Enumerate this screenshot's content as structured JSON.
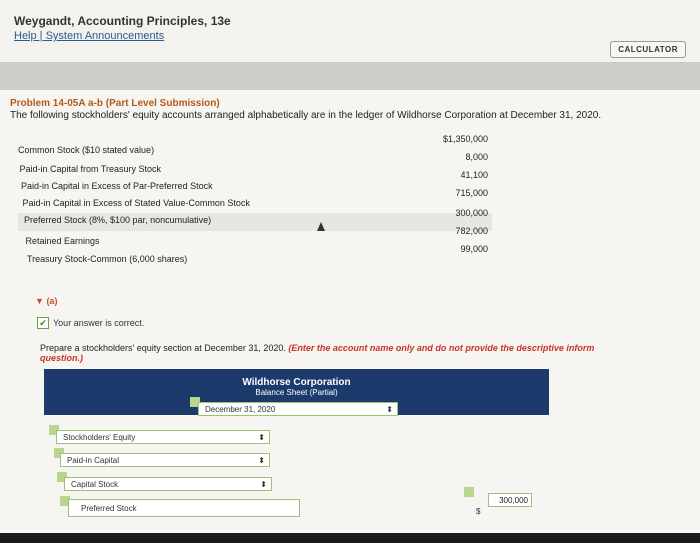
{
  "header": {
    "course": "Weygandt, Accounting Principles, 13e",
    "links": "Help | System Announcements",
    "calculator": "CALCULATOR"
  },
  "problem": {
    "title": "Problem 14-05A a-b (Part Level Submission)",
    "description": "The following stockholders' equity accounts arranged alphabetically are in the ledger of Wildhorse Corporation at December 31, 2020.",
    "accounts": [
      {
        "name": "Common Stock ($10 stated value)",
        "amount": "$1,350,000"
      },
      {
        "name": "Paid-in Capital from Treasury Stock",
        "amount": "8,000"
      },
      {
        "name": "Paid-in Capital in Excess of Par-Preferred Stock",
        "amount": "41,100"
      },
      {
        "name": "Paid-in Capital in Excess of Stated Value-Common Stock",
        "amount": "715,000"
      },
      {
        "name": "Preferred Stock (8%, $100 par, noncumulative)",
        "amount": "300,000"
      },
      {
        "name": "Retained Earnings",
        "amount": "782,000"
      },
      {
        "name": "Treasury Stock-Common (6,000 shares)",
        "amount": "99,000"
      }
    ]
  },
  "part_a": {
    "toggle": "(a)",
    "correct": "Your answer is correct.",
    "instruction": "Prepare a stockholders' equity section at December 31, 2020.",
    "instruction_red": "(Enter the account name only and do not provide the descriptive inform",
    "instruction_red2": "question.)",
    "company": "Wildhorse Corporation",
    "sheet": "Balance Sheet (Partial)",
    "date": "December 31, 2020",
    "rows": [
      "Stockholders' Equity",
      "Paid-in Capital",
      "Capital Stock",
      "Preferred Stock"
    ],
    "preferred_value": "300,000",
    "dollar": "$"
  }
}
